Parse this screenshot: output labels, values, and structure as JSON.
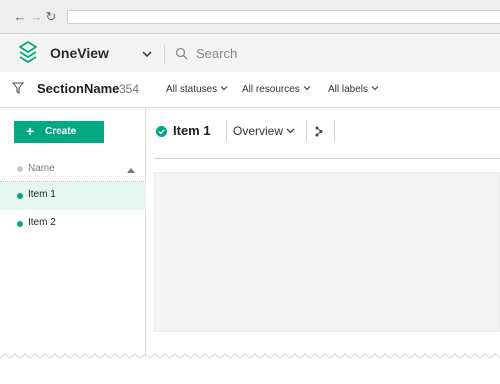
{
  "browser": {
    "back_icon": "arrow-left-icon",
    "forward_icon": "arrow-right-icon",
    "reload_icon": "reload-icon",
    "url": ""
  },
  "header": {
    "app_name": "OneView",
    "logo_icon": "stacked-layers-logo",
    "search_placeholder": "Search",
    "accent_color": "#01a982"
  },
  "filter_bar": {
    "section_name": "SectionName",
    "count": "354",
    "filters": [
      {
        "label": "All statuses"
      },
      {
        "label": "All resources"
      },
      {
        "label": "All labels"
      }
    ]
  },
  "left_panel": {
    "create_label": "Create",
    "column_header": "Name",
    "items": [
      {
        "label": "Item 1",
        "status": "ok",
        "selected": true
      },
      {
        "label": "Item 2",
        "status": "ok",
        "selected": false
      }
    ]
  },
  "main": {
    "title": "Item 1",
    "status": "ok",
    "view_label": "Overview"
  }
}
